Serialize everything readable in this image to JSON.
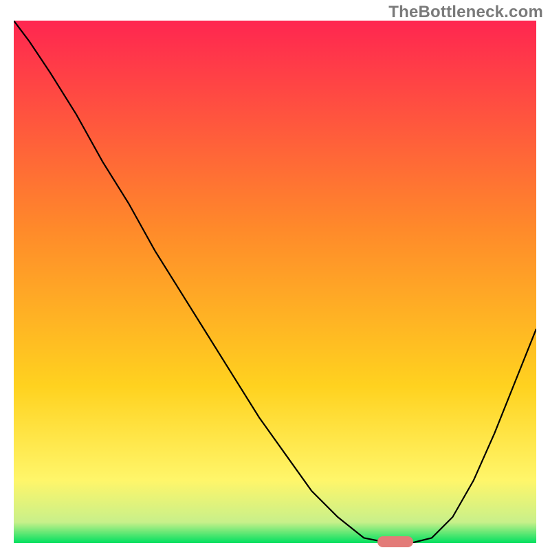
{
  "watermark": "TheBottleneck.com",
  "chart_data": {
    "type": "line",
    "title": "",
    "xlabel": "",
    "ylabel": "",
    "x": [
      0.0,
      0.03,
      0.07,
      0.12,
      0.17,
      0.22,
      0.27,
      0.32,
      0.37,
      0.42,
      0.47,
      0.52,
      0.57,
      0.62,
      0.67,
      0.72,
      0.76,
      0.8,
      0.84,
      0.88,
      0.92,
      0.96,
      1.0
    ],
    "values": [
      1.0,
      0.96,
      0.9,
      0.82,
      0.73,
      0.65,
      0.56,
      0.48,
      0.4,
      0.32,
      0.24,
      0.17,
      0.1,
      0.05,
      0.01,
      0.0,
      0.0,
      0.01,
      0.05,
      0.12,
      0.21,
      0.31,
      0.41
    ],
    "ylim": [
      0,
      1
    ],
    "xlim": [
      0,
      1
    ],
    "annotations": [
      {
        "name": "optimal-marker",
        "x": 0.73,
        "y": 0.0,
        "color": "#e37b78"
      }
    ],
    "background_gradient": {
      "stops": [
        {
          "offset": 0.0,
          "color": "#ff2650"
        },
        {
          "offset": 0.4,
          "color": "#ff8a2a"
        },
        {
          "offset": 0.7,
          "color": "#ffd21f"
        },
        {
          "offset": 0.88,
          "color": "#fff66a"
        },
        {
          "offset": 0.96,
          "color": "#c8f08a"
        },
        {
          "offset": 1.0,
          "color": "#00e060"
        }
      ]
    }
  }
}
